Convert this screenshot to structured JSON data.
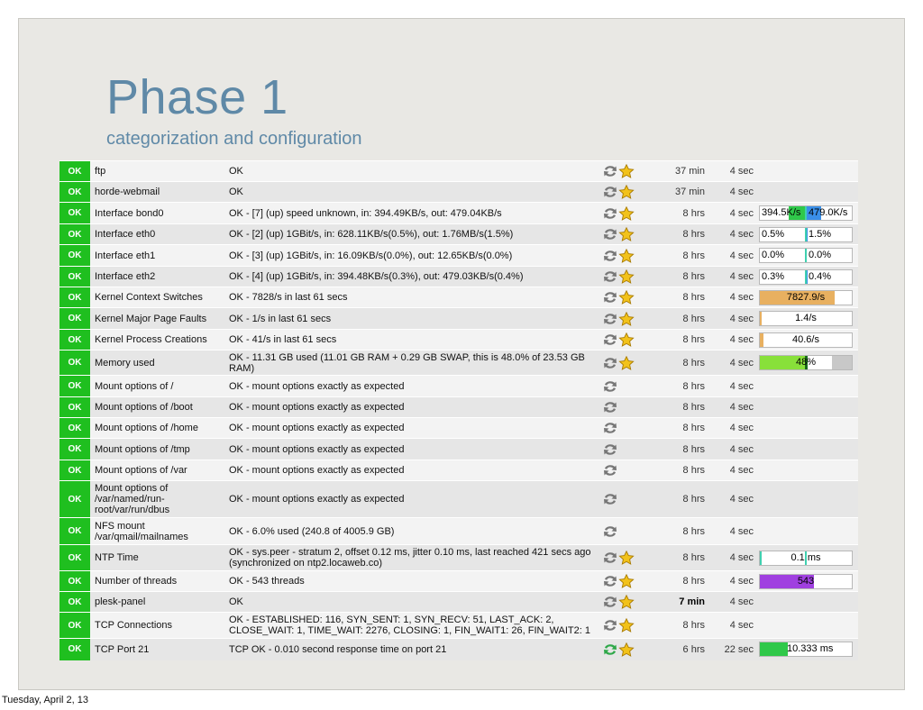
{
  "slide": {
    "title": "Phase 1",
    "subtitle": "categorization and configuration",
    "footer_date": "Tuesday, April 2, 13"
  },
  "rows": [
    {
      "state": "OK",
      "service": "ftp",
      "output": "OK",
      "age": "37 min",
      "checked": "4 sec",
      "star": true,
      "refresh_color": "#777777"
    },
    {
      "state": "OK",
      "service": "horde-webmail",
      "output": "OK",
      "age": "37 min",
      "checked": "4 sec",
      "star": true,
      "refresh_color": "#777777"
    },
    {
      "state": "OK",
      "service": "Interface bond0",
      "output": "OK - [7] (up) speed unknown, in: 394.49KB/s, out: 479.04KB/s",
      "age": "8 hrs",
      "checked": "4 sec",
      "star": true,
      "refresh_color": "#777777",
      "perf": {
        "kind": "split",
        "left_label": "394.5K/s",
        "right_label": "479.0K/s",
        "left_fill": 0.35,
        "right_fill": 0.3,
        "left_color": "#2fc84a",
        "right_color": "#3a8fe8"
      }
    },
    {
      "state": "OK",
      "service": "Interface eth0",
      "output": "OK - [2] (up) 1GBit/s, in: 628.11KB/s(0.5%), out: 1.76MB/s(1.5%)",
      "age": "8 hrs",
      "checked": "4 sec",
      "star": true,
      "refresh_color": "#777777",
      "perf": {
        "kind": "split",
        "left_label": "0.5%",
        "right_label": "1.5%",
        "left_fill": 0.005,
        "right_fill": 0.015,
        "left_color": "#2fc84a",
        "right_color": "#3a8fe8"
      }
    },
    {
      "state": "OK",
      "service": "Interface eth1",
      "output": "OK - [3] (up) 1GBit/s, in: 16.09KB/s(0.0%), out: 12.65KB/s(0.0%)",
      "age": "8 hrs",
      "checked": "4 sec",
      "star": true,
      "refresh_color": "#777777",
      "perf": {
        "kind": "split",
        "left_label": "0.0%",
        "right_label": "0.0%",
        "left_fill": 0,
        "right_fill": 0,
        "left_color": "#2fc84a",
        "right_color": "#3a8fe8"
      }
    },
    {
      "state": "OK",
      "service": "Interface eth2",
      "output": "OK - [4] (up) 1GBit/s, in: 394.48KB/s(0.3%), out: 479.03KB/s(0.4%)",
      "age": "8 hrs",
      "checked": "4 sec",
      "star": true,
      "refresh_color": "#777777",
      "perf": {
        "kind": "split",
        "left_label": "0.3%",
        "right_label": "0.4%",
        "left_fill": 0.003,
        "right_fill": 0.004,
        "left_color": "#2fc84a",
        "right_color": "#3a8fe8"
      }
    },
    {
      "state": "OK",
      "service": "Kernel Context Switches",
      "output": "OK - 7828/s in last 61 secs",
      "age": "8 hrs",
      "checked": "4 sec",
      "star": true,
      "refresh_color": "#777777",
      "perf": {
        "kind": "single",
        "label": "7827.9/s",
        "fill": 0.8,
        "color": "#e8b060"
      }
    },
    {
      "state": "OK",
      "service": "Kernel Major Page Faults",
      "output": "OK - 1/s in last 61 secs",
      "age": "8 hrs",
      "checked": "4 sec",
      "star": true,
      "refresh_color": "#777777",
      "perf": {
        "kind": "single",
        "label": "1.4/s",
        "fill": 0.02,
        "color": "#e8b060"
      }
    },
    {
      "state": "OK",
      "service": "Kernel Process Creations",
      "output": "OK - 41/s in last 61 secs",
      "age": "8 hrs",
      "checked": "4 sec",
      "star": true,
      "refresh_color": "#777777",
      "perf": {
        "kind": "single",
        "label": "40.6/s",
        "fill": 0.04,
        "color": "#e8b060"
      }
    },
    {
      "state": "OK",
      "service": "Memory used",
      "output": "OK - 11.31 GB used (11.01 GB RAM + 0.29 GB SWAP, this is 48.0% of 23.53 GB RAM)",
      "age": "8 hrs",
      "checked": "4 sec",
      "star": true,
      "refresh_color": "#777777",
      "perf": {
        "kind": "memory",
        "label": "48%",
        "fill": 0.48,
        "color": "#88e03a"
      }
    },
    {
      "state": "OK",
      "service": "Mount options of /",
      "output": "OK - mount options exactly as expected",
      "age": "8 hrs",
      "checked": "4 sec",
      "star": false,
      "refresh_color": "#777777"
    },
    {
      "state": "OK",
      "service": "Mount options of /boot",
      "output": "OK - mount options exactly as expected",
      "age": "8 hrs",
      "checked": "4 sec",
      "star": false,
      "refresh_color": "#777777"
    },
    {
      "state": "OK",
      "service": "Mount options of /home",
      "output": "OK - mount options exactly as expected",
      "age": "8 hrs",
      "checked": "4 sec",
      "star": false,
      "refresh_color": "#777777"
    },
    {
      "state": "OK",
      "service": "Mount options of /tmp",
      "output": "OK - mount options exactly as expected",
      "age": "8 hrs",
      "checked": "4 sec",
      "star": false,
      "refresh_color": "#777777"
    },
    {
      "state": "OK",
      "service": "Mount options of /var",
      "output": "OK - mount options exactly as expected",
      "age": "8 hrs",
      "checked": "4 sec",
      "star": false,
      "refresh_color": "#777777"
    },
    {
      "state": "OK",
      "service": "Mount options of /var/named/run-root/var/run/dbus",
      "output": "OK - mount options exactly as expected",
      "age": "8 hrs",
      "checked": "4 sec",
      "star": false,
      "refresh_color": "#777777"
    },
    {
      "state": "OK",
      "service": "NFS mount /var/qmail/mailnames",
      "output": "OK - 6.0% used (240.8 of 4005.9 GB)",
      "age": "8 hrs",
      "checked": "4 sec",
      "star": false,
      "refresh_color": "#777777"
    },
    {
      "state": "OK",
      "service": "NTP Time",
      "output": "OK - sys.peer - stratum 2, offset 0.12 ms, jitter 0.10 ms, last reached 421 secs ago (synchronized on ntp2.locaweb.co)",
      "age": "8 hrs",
      "checked": "4 sec",
      "star": true,
      "refresh_color": "#777777",
      "perf": {
        "kind": "single",
        "label": "0.1 ms",
        "fill": 0.01,
        "color": "#3fd0b0",
        "marker": true
      }
    },
    {
      "state": "OK",
      "service": "Number of threads",
      "output": "OK - 543 threads",
      "age": "8 hrs",
      "checked": "4 sec",
      "star": true,
      "refresh_color": "#777777",
      "perf": {
        "kind": "single",
        "label": "543",
        "fill": 0.58,
        "color": "#a040e0"
      }
    },
    {
      "state": "OK",
      "service": "plesk-panel",
      "output": "OK",
      "age": "7 min",
      "checked": "4 sec",
      "star": true,
      "refresh_color": "#777777",
      "age_bold": true
    },
    {
      "state": "OK",
      "service": "TCP Connections",
      "output": "OK - ESTABLISHED: 116, SYN_SENT: 1, SYN_RECV: 51, LAST_ACK: 2, CLOSE_WAIT: 1, TIME_WAIT: 2276, CLOSING: 1, FIN_WAIT1: 26, FIN_WAIT2: 1",
      "age": "8 hrs",
      "checked": "4 sec",
      "star": true,
      "refresh_color": "#777777"
    },
    {
      "state": "OK",
      "service": "TCP Port 21",
      "output": "TCP OK - 0.010 second response time on port 21",
      "age": "6 hrs",
      "checked": "22 sec",
      "star": true,
      "refresh_color": "#2fa84a",
      "perf": {
        "kind": "single",
        "label": "10.333 ms",
        "fill": 0.3,
        "color": "#2fc84a",
        "label_right": true
      }
    }
  ],
  "icons": {
    "refresh": "refresh-arrows-icon",
    "star": "star-icon"
  },
  "colors": {
    "ok": "#1fbf1f",
    "title": "#5f89a7"
  }
}
